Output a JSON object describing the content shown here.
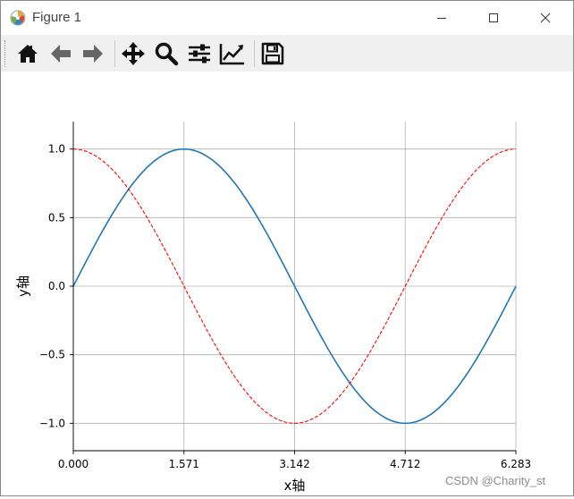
{
  "window": {
    "title": "Figure 1"
  },
  "toolbar": {
    "tools": [
      {
        "name": "home-icon",
        "label": "Home"
      },
      {
        "name": "back-icon",
        "label": "Back"
      },
      {
        "name": "forward-icon",
        "label": "Forward"
      },
      {
        "name": "pan-icon",
        "label": "Pan"
      },
      {
        "name": "zoom-icon",
        "label": "Zoom"
      },
      {
        "name": "configure-subplots-icon",
        "label": "Subplots"
      },
      {
        "name": "edit-curve-icon",
        "label": "Customize"
      },
      {
        "name": "save-icon",
        "label": "Save"
      }
    ]
  },
  "chart_data": {
    "type": "line",
    "xlabel": "x轴",
    "ylabel": "y轴",
    "xlim": [
      0,
      6.283
    ],
    "ylim": [
      -1.2,
      1.2
    ],
    "xticks": [
      0.0,
      1.571,
      3.142,
      4.712,
      6.283
    ],
    "xtick_labels": [
      "0.000",
      "1.571",
      "3.142",
      "4.712",
      "6.283"
    ],
    "yticks": [
      -1.0,
      -0.5,
      0.0,
      0.5,
      1.0
    ],
    "ytick_labels": [
      "−1.0",
      "−0.5",
      "0.0",
      "0.5",
      "1.0"
    ],
    "grid": true,
    "series": [
      {
        "function": "sin",
        "color": "#1f77b4",
        "linestyle": "solid",
        "samples": 121
      },
      {
        "function": "cos",
        "color": "#ff0000",
        "linestyle": "dashed",
        "samples": 121
      }
    ]
  },
  "watermark": "CSDN @Charity_st"
}
